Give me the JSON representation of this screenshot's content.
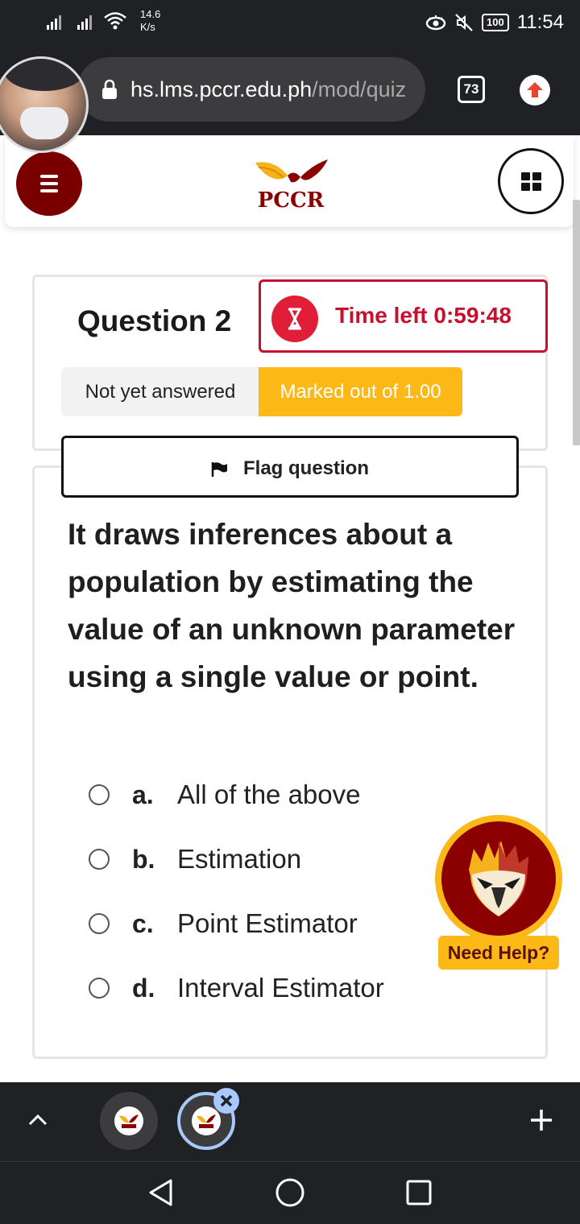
{
  "status_bar": {
    "net_speed_value": "14.6",
    "net_speed_unit": "K/s",
    "battery": "100",
    "time": "11:54"
  },
  "browser": {
    "url_main": "hs.lms.pccr.edu.ph",
    "url_dim": "/mod/quiz",
    "tab_count": "73"
  },
  "header": {
    "logo_text": "PCCR"
  },
  "question_info": {
    "title": "Question 2",
    "timer_label": "Time left 0:59:48",
    "status": "Not yet answered",
    "marks": "Marked out of 1.00",
    "flag_label": "Flag question"
  },
  "question": {
    "text": "It draws inferences about a population by estimating the value of an unknown parameter using a single value or point.",
    "options": [
      {
        "letter": "a.",
        "text": "All of the above"
      },
      {
        "letter": "b.",
        "text": "Estimation"
      },
      {
        "letter": "c.",
        "text": "Point Estimator"
      },
      {
        "letter": "d.",
        "text": "Interval Estimator"
      }
    ]
  },
  "helper": {
    "label": "Need Help?"
  },
  "colors": {
    "brand_maroon": "#7a0000",
    "timer_red": "#c8102e",
    "accent_yellow": "#fbb816",
    "chrome_dark": "#202124"
  }
}
